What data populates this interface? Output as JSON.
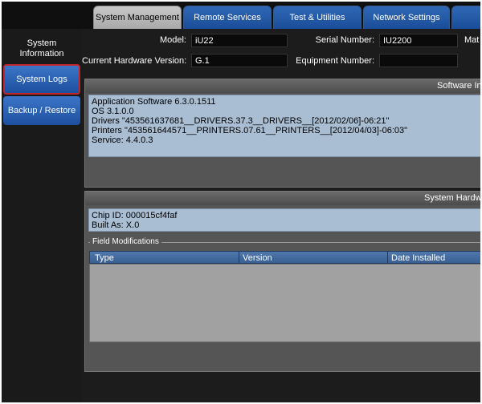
{
  "tabs": [
    {
      "label": "System Management",
      "active": true
    },
    {
      "label": "Remote Services",
      "active": false
    },
    {
      "label": "Test & Utilities",
      "active": false
    },
    {
      "label": "Network Settings",
      "active": false
    },
    {
      "label": "",
      "active": false
    }
  ],
  "sidebar": {
    "items": [
      {
        "label": "System Information"
      },
      {
        "label": "System Logs"
      },
      {
        "label": "Backup / Restore"
      }
    ]
  },
  "fields": {
    "model_label": "Model:",
    "model_value": "iU22",
    "serial_label": "Serial Number:",
    "serial_value": "IU2200",
    "mat_label": "Mat",
    "hw_label": "Current Hardware Version:",
    "hw_value": "G.1",
    "equip_label": "Equipment Number:",
    "equip_value": ""
  },
  "software_panel": {
    "title": "Software In",
    "lines": [
      "Application Software 6.3.0.1511",
      "OS 3.1.0.0",
      "Drivers \"453561637681__DRIVERS.37.3__DRIVERS__[2012/02/06]-06:21\"",
      "Printers \"453561644571__PRINTERS.07.61__PRINTERS__[2012/04/03]-06:03\"",
      "Service: 4.4.0.3"
    ]
  },
  "hardware_panel": {
    "title": "System Hardwa",
    "lines": [
      "Chip ID: 000015cf4faf",
      "Built As: X.0"
    ],
    "field_mods_title": "Field Modifications",
    "columns": [
      "Type",
      "Version",
      "Date Installed"
    ]
  }
}
